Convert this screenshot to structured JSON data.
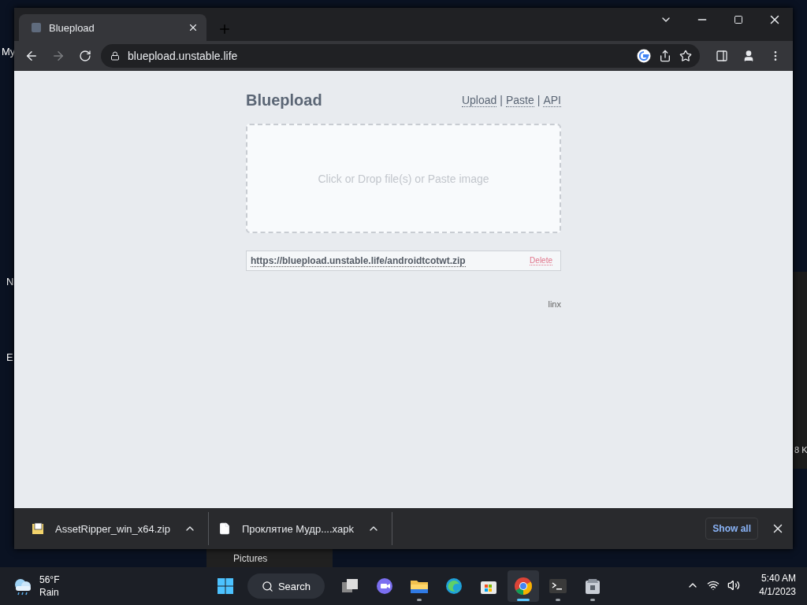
{
  "desktop": {
    "icon_labels": [
      "My",
      "N",
      "E"
    ],
    "behind_window": {
      "folder": "Pictures",
      "size_fragment": "8 K"
    }
  },
  "browser": {
    "tabs": [
      {
        "title": "Bluepload",
        "selected": true
      }
    ],
    "address": "bluepload.unstable.life"
  },
  "page": {
    "brand": "Bluepload",
    "nav": [
      {
        "label": "Upload"
      },
      {
        "label": "Paste"
      },
      {
        "label": "API"
      }
    ],
    "separator": "|",
    "dropzone": {
      "text": "Click or Drop file(s) or Paste image"
    },
    "uploads": [
      {
        "url": "https://bluepload.unstable.life/androidtcotwt.zip",
        "action": "Delete"
      }
    ],
    "footer": "linx"
  },
  "downloads": {
    "items": [
      {
        "name": "AssetRipper_win_x64.zip",
        "kind": "archive"
      },
      {
        "name": "Проклятие Мудр....xapk",
        "kind": "file"
      }
    ],
    "show_all": "Show all"
  },
  "taskbar": {
    "weather": {
      "temp": "56°F",
      "condition": "Rain"
    },
    "search": "Search",
    "apps": [
      {
        "kind": "taskview",
        "running": false,
        "selected": false
      },
      {
        "kind": "chat",
        "running": false,
        "selected": false
      },
      {
        "kind": "folder",
        "running": true,
        "selected": false
      },
      {
        "kind": "edge",
        "running": false,
        "selected": false
      },
      {
        "kind": "store",
        "running": false,
        "selected": false
      },
      {
        "kind": "chrome",
        "running": true,
        "selected": true
      },
      {
        "kind": "terminal",
        "running": true,
        "selected": false
      },
      {
        "kind": "box",
        "running": true,
        "selected": false
      }
    ],
    "time": "5:40 AM",
    "date": "4/1/2023"
  }
}
